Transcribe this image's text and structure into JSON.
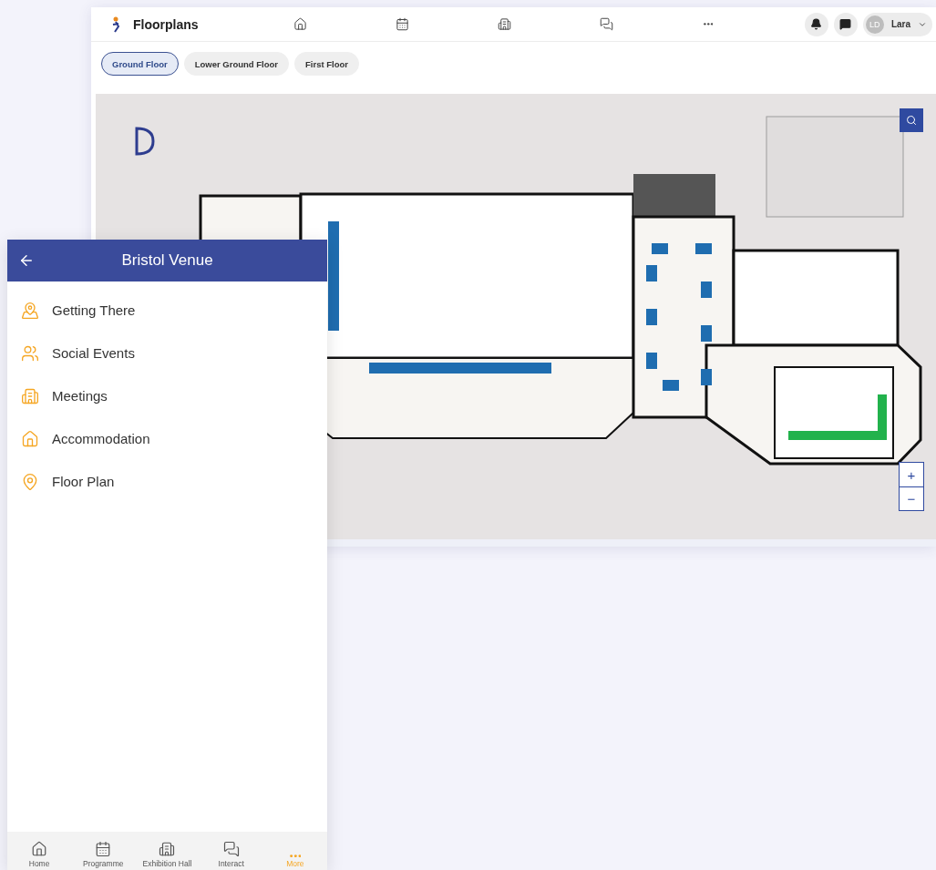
{
  "app_bar": {
    "title": "Floorplans",
    "nav": [
      {
        "kind": "home"
      },
      {
        "kind": "calendar"
      },
      {
        "kind": "building"
      },
      {
        "kind": "chat"
      },
      {
        "kind": "more"
      }
    ],
    "user": {
      "initials": "LD",
      "name": "Lara"
    }
  },
  "floor_tabs": [
    {
      "label": "Ground Floor",
      "selected": true
    },
    {
      "label": "Lower Ground Floor",
      "selected": false
    },
    {
      "label": "First Floor",
      "selected": false
    }
  ],
  "map_controls": {
    "zoom_in": "+",
    "zoom_out": "−"
  },
  "mobile": {
    "title": "Bristol Venue",
    "menu": [
      {
        "label": "Getting There",
        "kind": "map"
      },
      {
        "label": "Social Events",
        "kind": "people"
      },
      {
        "label": "Meetings",
        "kind": "building"
      },
      {
        "label": "Accommodation",
        "kind": "home"
      },
      {
        "label": "Floor Plan",
        "kind": "pin"
      }
    ],
    "bottom_nav": [
      {
        "label": "Home",
        "kind": "home",
        "selected": false
      },
      {
        "label": "Programme",
        "kind": "calendar",
        "selected": false
      },
      {
        "label": "Exhibition Hall",
        "kind": "building",
        "selected": false
      },
      {
        "label": "Interact",
        "kind": "chat",
        "selected": false
      },
      {
        "label": "More",
        "kind": "more",
        "selected": true
      }
    ]
  }
}
